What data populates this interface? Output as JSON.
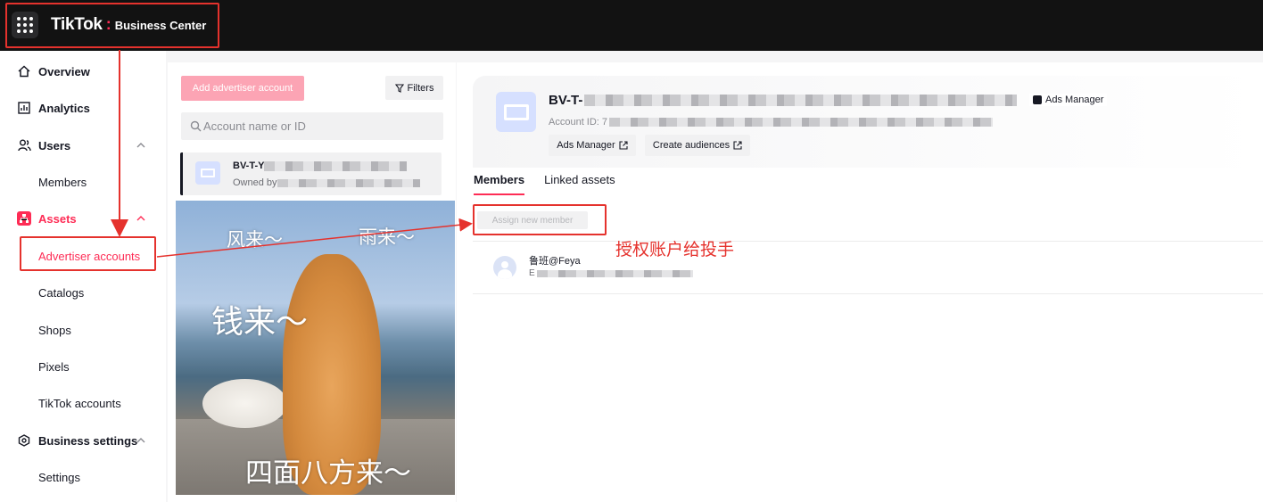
{
  "topbar": {
    "logo": "TikTok",
    "separator": ":",
    "product": "Business Center"
  },
  "sidebar": {
    "items": [
      {
        "label": "Overview",
        "icon": "home-icon"
      },
      {
        "label": "Analytics",
        "icon": "chart-icon"
      },
      {
        "label": "Users",
        "icon": "users-icon"
      },
      {
        "label": "Members"
      },
      {
        "label": "Assets",
        "icon": "assets-icon"
      },
      {
        "label": "Advertiser accounts"
      },
      {
        "label": "Catalogs"
      },
      {
        "label": "Shops"
      },
      {
        "label": "Pixels"
      },
      {
        "label": "TikTok accounts"
      },
      {
        "label": "Business settings",
        "icon": "settings-icon"
      },
      {
        "label": "Settings"
      }
    ]
  },
  "list": {
    "add_button": "Add advertiser account",
    "filters_button": "Filters",
    "search_placeholder": "Account name or ID",
    "account": {
      "name": "BV-T-Y",
      "owner_prefix": "Owned by"
    }
  },
  "meme": {
    "text1": "风来～",
    "text2": "雨来～",
    "text3": "钱来～",
    "text4": "四面八方来～"
  },
  "detail": {
    "account_title": "BV-T-",
    "ads_manager_tag": "Ads Manager",
    "account_id_prefix": "Account ID: 7",
    "ads_manager_button": "Ads Manager",
    "create_audiences_button": "Create audiences",
    "tabs": [
      "Members",
      "Linked assets"
    ],
    "assign_button": "Assign new member",
    "member": {
      "name": "鲁班@Feya",
      "email_prefix": "E"
    }
  },
  "annotation": {
    "text": "授权账户给投手",
    "color": "#e5322d"
  },
  "colors": {
    "brand_accent": "#fe2c55",
    "topbar_bg": "#121212"
  }
}
